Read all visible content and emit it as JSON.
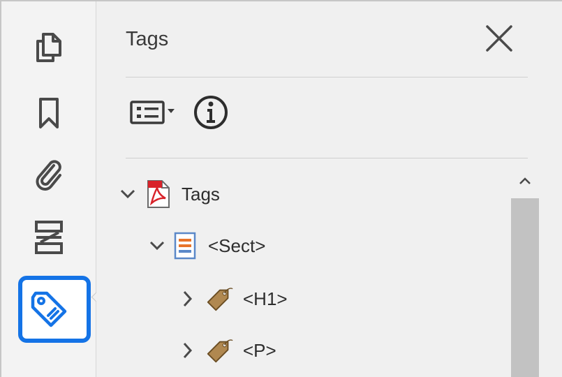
{
  "panel": {
    "title": "Tags",
    "close_icon": "close-icon",
    "toolbar": {
      "options_icon": "options-menu-icon",
      "info_icon": "info-icon"
    }
  },
  "rail": {
    "items": [
      {
        "name": "page-thumbnails",
        "icon": "pages-icon"
      },
      {
        "name": "bookmarks",
        "icon": "bookmark-icon"
      },
      {
        "name": "attachments",
        "icon": "paperclip-icon"
      },
      {
        "name": "order",
        "icon": "order-icon"
      },
      {
        "name": "tags",
        "icon": "tag-icon",
        "selected": true
      }
    ],
    "accent_color": "#1473e6"
  },
  "tree": {
    "nodes": [
      {
        "label": "Tags",
        "level": 0,
        "expanded": true,
        "icon": "pdf-icon"
      },
      {
        "label": "<Sect>",
        "level": 1,
        "expanded": true,
        "icon": "section-icon"
      },
      {
        "label": "<H1>",
        "level": 2,
        "expanded": false,
        "icon": "tag-icon"
      },
      {
        "label": "<P>",
        "level": 2,
        "expanded": false,
        "icon": "tag-icon"
      }
    ]
  }
}
